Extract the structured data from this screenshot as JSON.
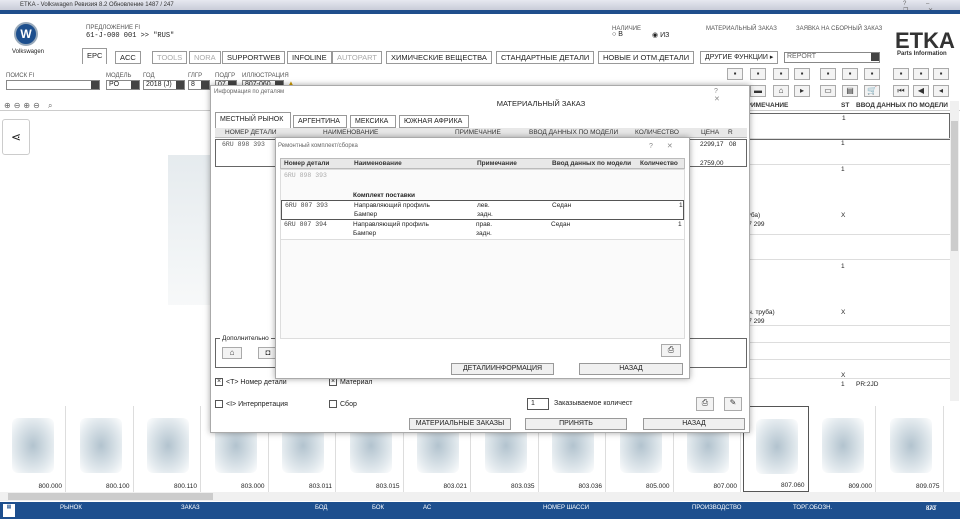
{
  "window": {
    "title": "ETKA - Volkswagen Ревизия 8.2 Обновление 1487 / 247",
    "controls": [
      "?",
      "–",
      "❐",
      "✕"
    ]
  },
  "brand": {
    "name": "Volkswagen",
    "etka": "ETKA",
    "etka_sub": "Parts Information"
  },
  "offer": {
    "label": "ПРЕДЛОЖЕНИЕ FI",
    "value": "61-J-000 001 >> \"RUS\""
  },
  "availability": {
    "label": "НАЛИЧИЕ",
    "options": [
      {
        "label": "В",
        "selected": false
      },
      {
        "label": "ИЗ",
        "selected": true
      }
    ]
  },
  "header_links": [
    "МАТЕРИАЛЬНЫЙ ЗАКАЗ",
    "ЗАЯВКА НА СБОРНЫЙ ЗАКАЗ"
  ],
  "tabs": [
    {
      "label": "EPC",
      "state": "active"
    },
    {
      "label": "ACC",
      "state": "normal"
    },
    {
      "label": "TOOLS",
      "state": "disabled"
    },
    {
      "label": "NORA",
      "state": "disabled"
    },
    {
      "label": "SUPPORTWEB",
      "state": "normal"
    },
    {
      "label": "INFOLINE",
      "state": "normal"
    },
    {
      "label": "AUTOPART",
      "state": "disabled"
    },
    {
      "label": "ХИМИЧЕСКИЕ ВЕЩЕСТВА",
      "state": "normal"
    },
    {
      "label": "СТАНДАРТНЫЕ ДЕТАЛИ",
      "state": "normal"
    },
    {
      "label": "НОВЫЕ И ОТМ.ДЕТАЛИ",
      "state": "normal"
    }
  ],
  "other_functions": {
    "label": "ДРУГИЕ ФУНКЦИИ ▸",
    "value": "REPORT"
  },
  "filters": [
    {
      "label": "ПОИСК FI",
      "value": ""
    },
    {
      "label": "МОДЕЛЬ",
      "value": "PO"
    },
    {
      "label": "ГОД",
      "value": "2018 (J)"
    },
    {
      "label": "ГЛГР",
      "value": "8"
    },
    {
      "label": "ПОДГР",
      "value": "07"
    },
    {
      "label": "ИЛЛЮСТРАЦИЯ",
      "value": "807-060"
    }
  ],
  "right_table": {
    "headers": [
      "ПРИМЕЧАНИЕ",
      "ST",
      "ВВОД ДАННЫХ ПО МОДЕЛИ"
    ],
    "rows": [
      {
        "note": "",
        "st": "1",
        "model": ""
      },
      {
        "note": "",
        "st": "1",
        "model": ""
      },
      {
        "note": "",
        "st": "1",
        "model": ""
      },
      {
        "note": "н.\nтруба)\n867 299",
        "st": "X",
        "model": ""
      },
      {
        "note": "ін.",
        "st": "1",
        "model": ""
      },
      {
        "note": "н.\nойн. труба)\n867 299",
        "st": "X",
        "model": ""
      },
      {
        "note": "",
        "st": "X",
        "model": ""
      },
      {
        "note": "ін.",
        "st": "1",
        "model": "PR:2JD"
      }
    ]
  },
  "material_dialog": {
    "title": "Информация по деталям",
    "heading": "МАТЕРИАЛЬНЫЙ ЗАКАЗ",
    "tabs": [
      "МЕСТНЫЙ РЫНОК",
      "АРГЕНТИНА",
      "МЕКСИКА",
      "ЮЖНАЯ АФРИКА"
    ],
    "headers": [
      "НОМЕР ДЕТАЛИ",
      "НАИМЕНОВАНИЕ",
      "ПРИМЕЧАНИЕ",
      "ВВОД ДАННЫХ ПО МОДЕЛИ",
      "КОЛИЧЕСТВО",
      "ЦЕНА",
      "R"
    ],
    "row": {
      "part": "6RU 898 393",
      "price1": "2299,17",
      "r": "08",
      "price2": "2759,00"
    },
    "group_label": "Дополнительно",
    "checks": [
      {
        "label": "<T> Номер детали",
        "checked": true
      },
      {
        "label": "Материал",
        "checked": true
      },
      {
        "label": "<I> Интерпретация",
        "checked": false
      },
      {
        "label": "Сбор",
        "checked": false
      }
    ],
    "qty": {
      "value": "1",
      "label": "Заказываемое количест"
    },
    "buttons": [
      "МАТЕРИАЛЬНЫЕ ЗАКАЗЫ",
      "ПРИНЯТЬ",
      "НАЗАД"
    ]
  },
  "kit_dialog": {
    "title": "Ремонтный комплект/сборка",
    "headers": [
      "Номер детали",
      "Наименование",
      "Примечание",
      "Ввод данных по модели",
      "Количество"
    ],
    "parent": "6RU 898 393",
    "section": "Комплект поставки",
    "rows": [
      {
        "part": "6RU 807 393",
        "name1": "Направляющий профиль",
        "name2": "Бампер",
        "note1": "лев.",
        "note2": "задн.",
        "model": "Седан",
        "qty": "1"
      },
      {
        "part": "6RU 807 394",
        "name1": "Направляющий профиль",
        "name2": "Бампер",
        "note1": "прав.",
        "note2": "задн.",
        "model": "Седан",
        "qty": "1"
      }
    ],
    "buttons": [
      "ДЕТАЛИИНФОРМАЦИЯ",
      "НАЗАД"
    ]
  },
  "thumbnails": [
    "800.000",
    "800.100",
    "800.110",
    "803.000",
    "803.011",
    "803.015",
    "803.021",
    "803.035",
    "803.036",
    "805.000",
    "807.000",
    "807.060",
    "809.000",
    "809.075"
  ],
  "selected_thumbnail": "807.060",
  "statusbar": {
    "fields": [
      "РЫНОК",
      "ЗАКАЗ",
      "БОД",
      "БОК",
      "АС",
      "НОМЕР ШАССИ",
      "ПРОИЗВОДСТВО",
      "ТОРГ.ОБОЗН."
    ],
    "kat_label": "КАТ",
    "kat_value": "873"
  },
  "colors": {
    "brand_blue": "#1d4f8e"
  }
}
